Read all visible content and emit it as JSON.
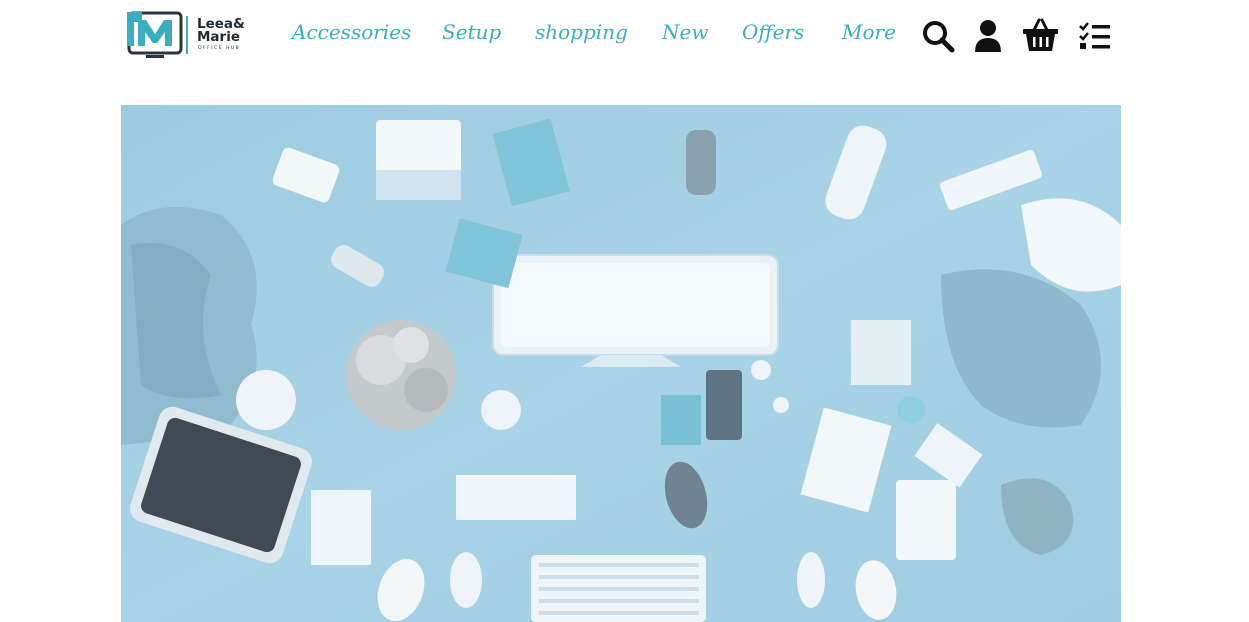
{
  "brand": {
    "logo_mark": "LM",
    "name_line1": "Leea&",
    "name_line2": "Marie",
    "tagline": "OFFICE HUB",
    "accent_color": "#3aaebf",
    "dark_color": "#2a3540"
  },
  "nav": {
    "items": [
      "Accessories",
      "Setup",
      "shopping",
      "New",
      "Offers",
      "More"
    ],
    "link_color": "#3aaebf"
  },
  "header_icons": [
    "search-icon",
    "user-icon",
    "basket-icon",
    "checklist-icon"
  ],
  "hero": {
    "background_color": "#a9d3e6",
    "description_icon": "office-desk-flatlay-image"
  }
}
